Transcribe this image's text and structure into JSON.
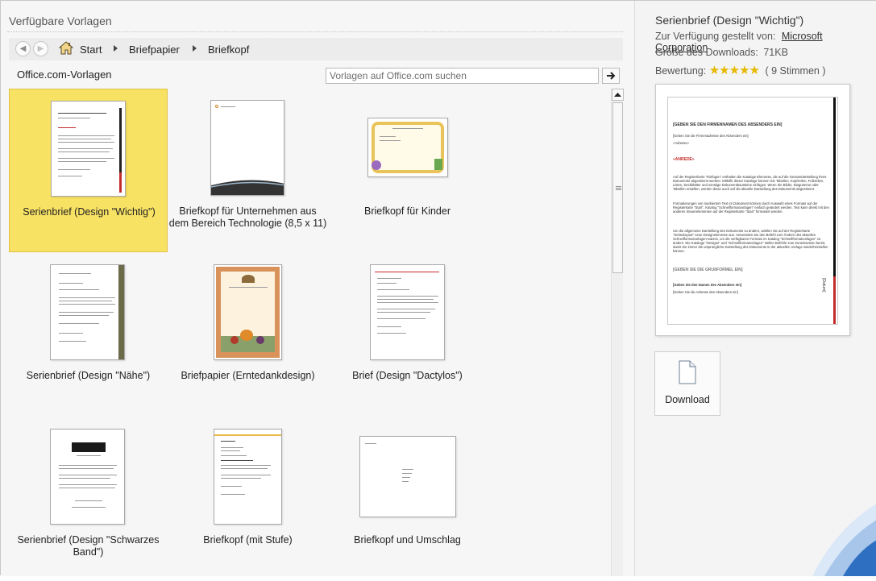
{
  "header": {
    "title": "Verfügbare Vorlagen"
  },
  "nav": {
    "back_icon": "arrow-left-icon",
    "forward_icon": "arrow-right-icon",
    "home_icon": "home-icon",
    "breadcrumbs": [
      "Start",
      "Briefpapier",
      "Briefkopf"
    ]
  },
  "search": {
    "source_label": "Office.com-Vorlagen",
    "placeholder": "Vorlagen auf Office.com suchen",
    "go_icon": "arrow-right-icon"
  },
  "templates": [
    {
      "label": "Serienbrief (Design \"Wichtig\")",
      "selected": true
    },
    {
      "label": "Briefkopf für Unternehmen aus dem Bereich Technologie (8,5 x 11)"
    },
    {
      "label": "Briefkopf für Kinder"
    },
    {
      "label": "Serienbrief (Design \"Nähe\")"
    },
    {
      "label": "Briefpapier (Erntedankdesign)"
    },
    {
      "label": "Brief (Design \"Dactylos\")"
    },
    {
      "label": "Serienbrief (Design \"Schwarzes Band\")"
    },
    {
      "label": "Briefkopf (mit Stufe)"
    },
    {
      "label": "Briefkopf und Umschlag"
    }
  ],
  "details": {
    "title": "Serienbrief (Design \"Wichtig\")",
    "provided_by_label": "Zur Verfügung gestellt von:",
    "provided_by_value": "Microsoft Corporation",
    "download_size_label": "Größe des Downloads:",
    "download_size_value": "71KB",
    "rating_label": "Bewertung:",
    "rating_stars": 5,
    "rating_votes": "( 9 Stimmen )",
    "download_label": "Download",
    "download_icon": "document-icon"
  },
  "preview": {
    "heading": "[GEBEN SIE DEN FIRMENNAMEN DES ABSENDERS EIN]",
    "sender_address": "[Geben Sie die Firmenadresse des Absenders ein]",
    "recipient": "«Adresse»",
    "salutation": "«ANREDE»",
    "body": [
      "Auf der Registerkarte \"Einfügen\" enthalten die Kataloge Elemente, die auf die Gesamtdarstellung Ihres Dokuments abgestimmt werden. Mithilfe dieser Kataloge können Sie Tabellen, Kopfzeilen, Fußzeilen, Listen, Deckblätter und sonstige Dokumentbausteine einfügen. Wenn Sie Bilder, Diagramme oder Tabellen erstellen, werden diese auch auf die aktuelle Darstellung des Dokuments abgestimmt.",
      "Formatierungen von markiertem Text im Dokument können durch Auswahl eines Formats auf der Registerkarte \"Start\", Katalog \"Schnellformatvorlagen\" einfach geändert werden. Text kann direkt mit den anderen Steuerelementen auf der Registerkarte \"Start\" formatiert werden.",
      "Um die allgemeine Darstellung des Dokuments zu ändern, wählen Sie auf der Registerkarte \"Seitenlayout\" neue Designelemente aus. Verwenden Sie den Befehl zum Ändern des aktuellen Schnellformatvorlagen-Satzes, um die verfügbaren Formate im Katalog \"Schnellformatvorlagen\" zu ändern. Die Kataloge \"Designs\" und \"Schnellformatvorlagen\" stellen Befehle zum Zurücksetzen bereit, damit Sie immer die ursprüngliche Darstellung des Dokuments in der aktuellen Vorlage wiederherstellen können."
    ],
    "closing": "[GEBEN SIE DIE GRUßFORMEL EIN]",
    "sender_name": "[Geben Sie den Namen des Absenders ein]",
    "sender_address_2": "[Geben Sie die Adresse des Absenders ein]",
    "date_label": "[Datum]"
  }
}
